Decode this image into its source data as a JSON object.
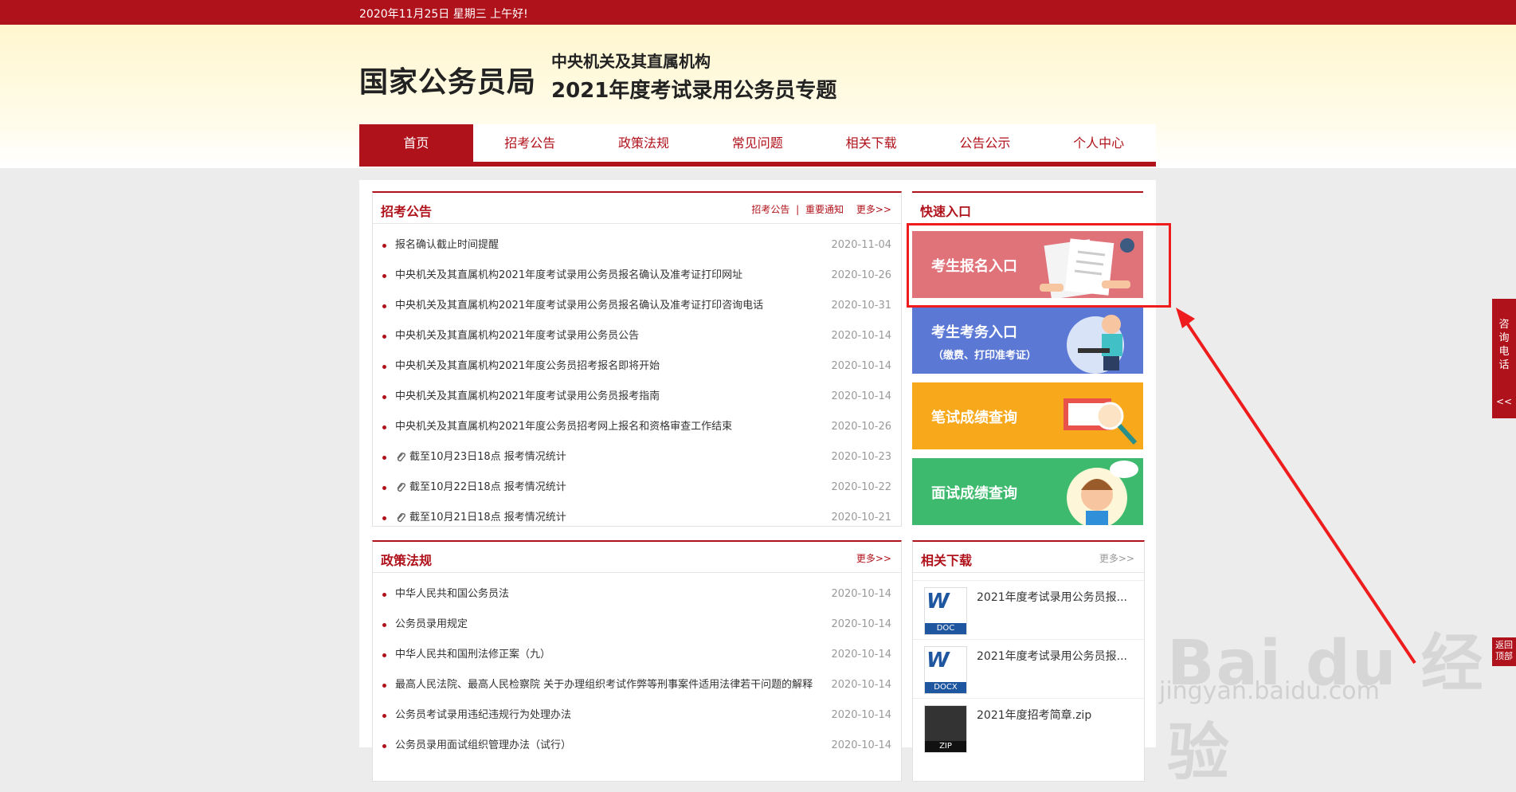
{
  "topbar": {
    "date_text": "2020年11月25日  星期三  上午好!"
  },
  "header": {
    "logo": "国家公务员局",
    "subtitle1": "中央机关及其直属机构",
    "subtitle2": "2021年度考试录用公务员专题"
  },
  "nav": {
    "items": [
      "首页",
      "招考公告",
      "政策法规",
      "常见问题",
      "相关下载",
      "公告公示",
      "个人中心"
    ],
    "active": "首页"
  },
  "announcements": {
    "title": "招考公告",
    "links": [
      "招考公告",
      "|",
      "重要通知",
      "更多>>"
    ],
    "items": [
      {
        "title": "报名确认截止时间提醒",
        "date": "2020-11-04",
        "attachment": false
      },
      {
        "title": "中央机关及其直属机构2021年度考试录用公务员报名确认及准考证打印网址",
        "date": "2020-10-26",
        "attachment": false
      },
      {
        "title": "中央机关及其直属机构2021年度考试录用公务员报名确认及准考证打印咨询电话",
        "date": "2020-10-31",
        "attachment": false
      },
      {
        "title": "中央机关及其直属机构2021年度考试录用公务员公告",
        "date": "2020-10-14",
        "attachment": false
      },
      {
        "title": "中央机关及其直属机构2021年度公务员招考报名即将开始",
        "date": "2020-10-14",
        "attachment": false
      },
      {
        "title": "中央机关及其直属机构2021年度考试录用公务员报考指南",
        "date": "2020-10-14",
        "attachment": false
      },
      {
        "title": "中央机关及其直属机构2021年度公务员招考网上报名和资格审查工作结束",
        "date": "2020-10-26",
        "attachment": false
      },
      {
        "title": "截至10月23日18点 报考情况统计",
        "date": "2020-10-23",
        "attachment": true
      },
      {
        "title": "截至10月22日18点 报考情况统计",
        "date": "2020-10-22",
        "attachment": true
      },
      {
        "title": "截至10月21日18点 报考情况统计",
        "date": "2020-10-21",
        "attachment": true
      }
    ]
  },
  "policies": {
    "title": "政策法规",
    "more": "更多>>",
    "items": [
      {
        "title": "中华人民共和国公务员法",
        "date": "2020-10-14"
      },
      {
        "title": "公务员录用规定",
        "date": "2020-10-14"
      },
      {
        "title": "中华人民共和国刑法修正案（九）",
        "date": "2020-10-14"
      },
      {
        "title": "最高人民法院、最高人民检察院 关于办理组织考试作弊等刑事案件适用法律若干问题的解释",
        "date": "2020-10-14"
      },
      {
        "title": "公务员考试录用违纪违规行为处理办法",
        "date": "2020-10-14"
      },
      {
        "title": "公务员录用面试组织管理办法（试行）",
        "date": "2020-10-14"
      }
    ]
  },
  "quick": {
    "title": "快速入口",
    "items": [
      {
        "label": "考生报名入口",
        "sub": "",
        "color": "#e0737a"
      },
      {
        "label": "考生考务入口",
        "sub": "（缴费、打印准考证）",
        "color": "#5b79d4"
      },
      {
        "label": "笔试成绩查询",
        "sub": "",
        "color": "#f7a81b"
      },
      {
        "label": "面试成绩查询",
        "sub": "",
        "color": "#3dba6d"
      }
    ]
  },
  "downloads": {
    "title": "相关下载",
    "more": "更多>>",
    "items": [
      {
        "name": "2021年度考试录用公务员报...",
        "type": "DOC"
      },
      {
        "name": "2021年度考试录用公务员报...",
        "type": "DOCX"
      },
      {
        "name": "2021年度招考简章.zip",
        "type": "ZIP"
      }
    ]
  },
  "side": {
    "consult": [
      "咨",
      "询",
      "电",
      "话"
    ],
    "arrows": "<<",
    "back_top": [
      "返回",
      "顶部"
    ]
  },
  "watermark": {
    "brand": "Bai du 经验",
    "url": "jingyan.baidu.com"
  }
}
